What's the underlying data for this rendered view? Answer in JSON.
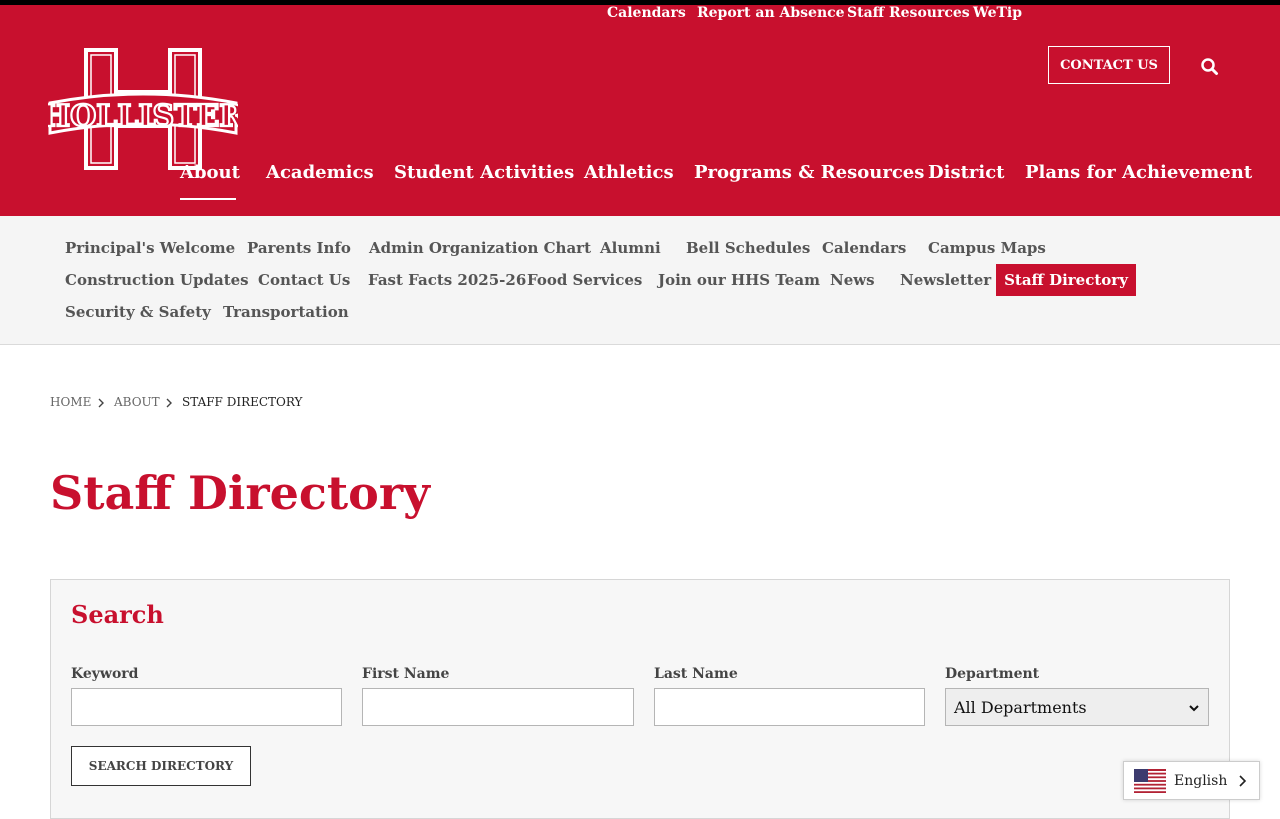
{
  "colors": {
    "brand_red": "#c8102e",
    "subnav_bg": "#f5f5f5",
    "text_gray": "#555555"
  },
  "logo": {
    "text": "HOLLISTER"
  },
  "utility_nav": {
    "links": [
      "Calendars",
      "Report an Absence",
      "Staff Resources",
      "WeTip"
    ],
    "contact_label": "CONTACT US",
    "search_icon": "search-icon"
  },
  "main_nav": {
    "items": [
      "About",
      "Academics",
      "Student Activities",
      "Athletics",
      "Programs & Resources",
      "District",
      "Plans for Achievement"
    ],
    "active": "About"
  },
  "sub_nav": {
    "items": [
      "Principal's Welcome",
      "Parents Info",
      "Admin Organization Chart",
      "Alumni",
      "Bell Schedules",
      "Calendars",
      "Campus Maps",
      "Construction Updates",
      "Contact Us",
      "Fast Facts 2025-26",
      "Food Services",
      "Join our HHS Team",
      "News",
      "Newsletter",
      "Staff Directory",
      "Security & Safety",
      "Transportation"
    ],
    "active": "Staff Directory"
  },
  "breadcrumb": {
    "items": [
      "HOME",
      "ABOUT",
      "STAFF DIRECTORY"
    ]
  },
  "page": {
    "title": "Staff Directory"
  },
  "search": {
    "title": "Search",
    "fields": {
      "keyword": {
        "label": "Keyword",
        "value": ""
      },
      "first_name": {
        "label": "First Name",
        "value": ""
      },
      "last_name": {
        "label": "Last Name",
        "value": ""
      },
      "department": {
        "label": "Department",
        "selected": "All Departments"
      }
    },
    "submit_label": "SEARCH DIRECTORY"
  },
  "language": {
    "label": "English",
    "flag_icon": "us-flag-icon"
  }
}
